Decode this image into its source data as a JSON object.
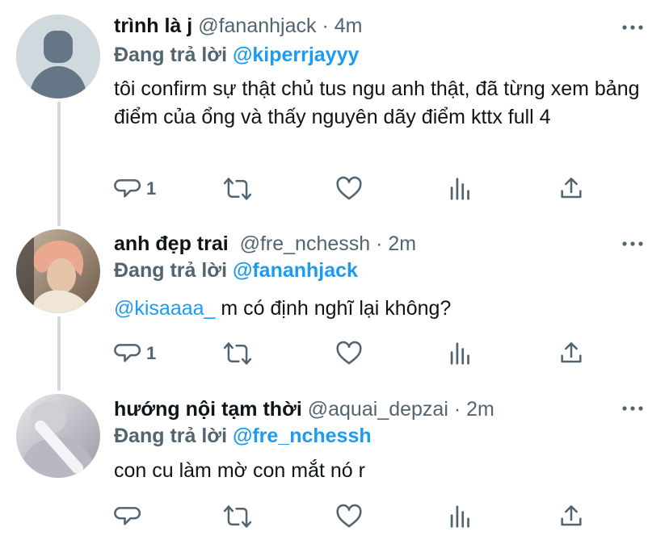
{
  "icons": {
    "reply": "speech-bubble-icon",
    "retweet": "retweet-icon",
    "like": "heart-icon",
    "views": "bar-chart-icon",
    "share": "share-icon",
    "more": "more-dots-icon"
  },
  "colors": {
    "link": "#1d9bf0",
    "muted": "#536471",
    "text": "#0f1419",
    "thread": "#cfd9de"
  },
  "tweets": [
    {
      "display_name": "trình là j",
      "handle": "@fananhjack",
      "separator": "·",
      "time": "4m",
      "reply_prefix": "Đang trả lời",
      "reply_to": "@kiperrjayyy",
      "mention": "",
      "text": "tôi confirm sự thật chủ tus ngu anh thật, đã từng xem bảng điểm của ổng và thấy nguyên dãy điểm kttx full 4",
      "reply_count": "1"
    },
    {
      "display_name": "anh đẹp trai",
      "handle": "@fre_nchessh",
      "separator": "·",
      "time": "2m",
      "reply_prefix": "Đang trả lời",
      "reply_to": "@fananhjack",
      "mention": "@kisaaaa_",
      "text": "m có định nghĩ lại không?",
      "reply_count": "1"
    },
    {
      "display_name": "hướng nội tạm thời",
      "handle": "@aquai_depzai",
      "separator": "·",
      "time": "2m",
      "reply_prefix": "Đang trả lời",
      "reply_to": "@fre_nchessh",
      "mention": "",
      "text": "con cu làm mờ con mắt nó r",
      "reply_count": ""
    }
  ]
}
